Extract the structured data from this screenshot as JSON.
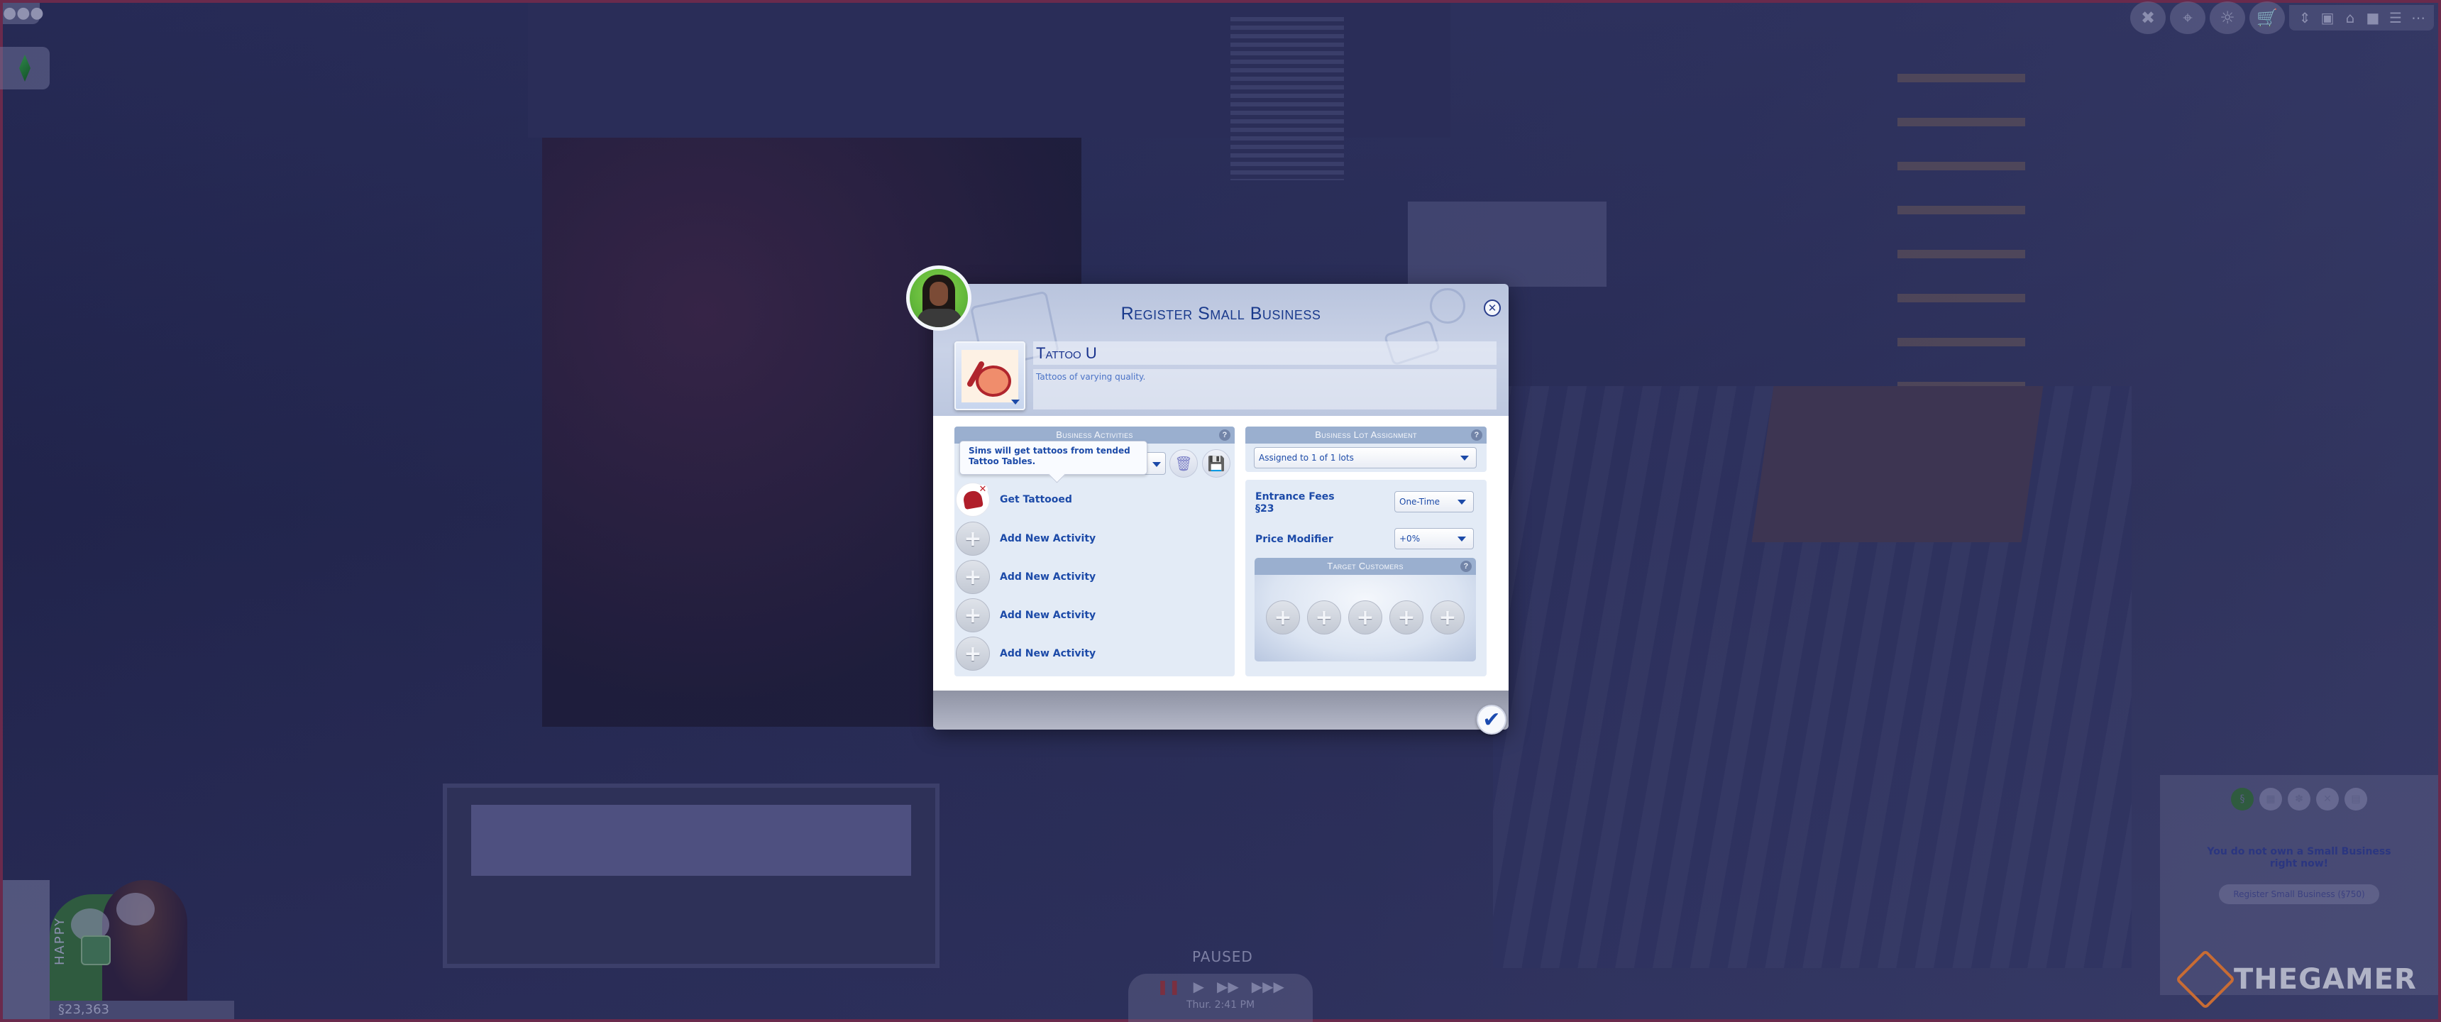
{
  "dialog": {
    "title": "Register Small Business",
    "business_name": "Tattoo U",
    "business_description": "Tattoos of varying quality.",
    "icons": {
      "avatar": "sim-portrait",
      "business_icon": "paint-palette-icon",
      "close": "close-icon",
      "confirm": "checkmark-icon"
    },
    "activities_panel": {
      "header": "Business Activities",
      "help": "?",
      "tooltip": "Sims will get tattoos from tended Tattoo Tables.",
      "items": [
        {
          "label": "Get Tattooed",
          "icon": "heart-tattoo-icon",
          "removable": true
        },
        {
          "label": "Add New Activity",
          "icon": "plus-icon"
        },
        {
          "label": "Add New Activity",
          "icon": "plus-icon"
        },
        {
          "label": "Add New Activity",
          "icon": "plus-icon"
        },
        {
          "label": "Add New Activity",
          "icon": "plus-icon"
        }
      ]
    },
    "lot_panel": {
      "header": "Business Lot Assignment",
      "help": "?",
      "selected": "Assigned to 1 of 1 lots"
    },
    "fees_panel": {
      "entrance_fees_label": "Entrance Fees",
      "entrance_fees_value": "§23",
      "entrance_fee_type": "One-Time",
      "price_modifier_label": "Price Modifier",
      "price_modifier_value": "+0%"
    },
    "target_customers": {
      "header": "Target Customers",
      "help": "?",
      "slot_count": 5,
      "slot_symbol": "+"
    },
    "plus_symbol": "+",
    "check_symbol": "✔",
    "close_symbol": "✕",
    "trash_symbol": "🗑",
    "save_symbol": "💾",
    "remove_symbol": "✕"
  },
  "hud": {
    "paused_label": "PAUSED",
    "clock": "Thur. 2:41 PM",
    "funds": "§23,363",
    "mood": "HAPPY",
    "top_right_icons": [
      "build-tools-icon",
      "map-pin-icon",
      "lightbulb-icon",
      "shopping-cart-icon",
      "camera-up-down-icon",
      "cube-icon",
      "home-icon",
      "camera-icon",
      "list-icon",
      "more-icon"
    ],
    "speed_controls": {
      "pause": "❚❚",
      "play": "▶",
      "fast": "▶▶",
      "ultra": "▶▶▶"
    },
    "small_business_panel": {
      "message": "You do not own a Small Business right now!",
      "register_button": "Register Small Business (§750)"
    }
  },
  "brand": {
    "watermark": "THEGAMER",
    "accent": "#c86c34"
  },
  "colors": {
    "dialog_title": "#1a3a8c",
    "link_blue": "#1c4aa8",
    "panel_header": "#9aafcf",
    "panel_bg": "#e3ebf6"
  }
}
